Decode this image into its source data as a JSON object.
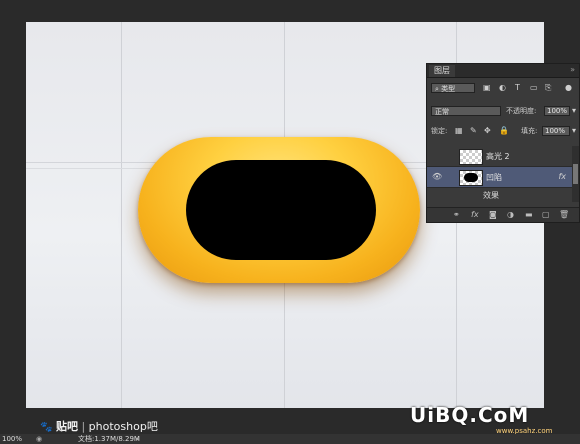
{
  "layers_panel": {
    "tab_label": "图层",
    "close_glyph": "»",
    "filter": {
      "icon": "search-icon",
      "value": "类型"
    },
    "blend_mode": {
      "value": "正常"
    },
    "opacity": {
      "label": "不透明度:",
      "value": "100%"
    },
    "lock": {
      "label": "锁定:"
    },
    "fill": {
      "label": "填充:",
      "value": "100%"
    },
    "layers": [
      {
        "name": "高光 2",
        "visible": false,
        "active": false
      },
      {
        "name": "凹陷",
        "visible": true,
        "active": true,
        "fx": "fx"
      }
    ],
    "effect_row": {
      "label": "效果"
    }
  },
  "status": {
    "zoom": "100%",
    "doc_info": "文档:1.37M/8.29M"
  },
  "watermark_baidu": {
    "brand": "贴吧",
    "separator": "|",
    "forum": "photoshop吧"
  },
  "watermark_uibq": {
    "text": "UiBQ.CoM",
    "url": "www.psahz.com"
  },
  "colors": {
    "pill_outer": "#f7b21d",
    "pill_highlight": "#ffe27a",
    "hole": "#000000",
    "panel_bg": "#3a3a3a",
    "active_layer": "#4f5a77"
  }
}
